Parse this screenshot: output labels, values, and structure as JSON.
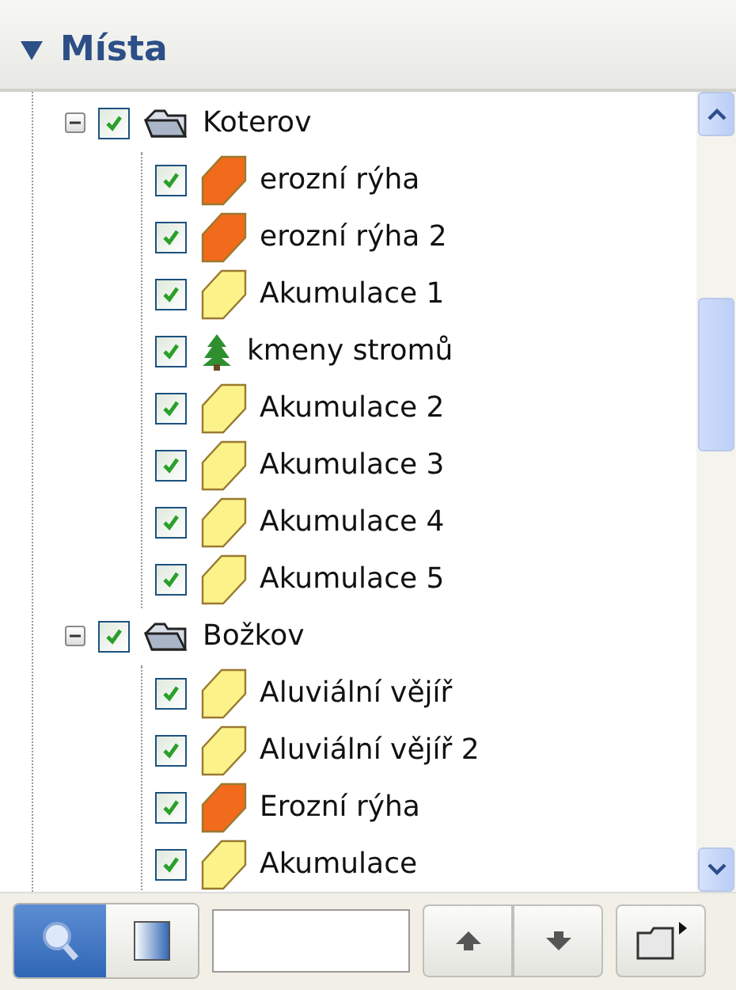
{
  "panel": {
    "title": "Místa",
    "expanded": true
  },
  "tree": [
    {
      "label": "Koterov",
      "kind": "folder",
      "checked": true,
      "expanded": true,
      "children": [
        {
          "label": "erozní rýha",
          "kind": "polygon",
          "color": "#f26a1b",
          "checked": true
        },
        {
          "label": "erozní rýha 2",
          "kind": "polygon",
          "color": "#f26a1b",
          "checked": true
        },
        {
          "label": "Akumulace 1",
          "kind": "polygon",
          "color": "#fbf38a",
          "checked": true
        },
        {
          "label": "kmeny stromů",
          "kind": "tree",
          "checked": true
        },
        {
          "label": "Akumulace 2",
          "kind": "polygon",
          "color": "#fbf38a",
          "checked": true
        },
        {
          "label": "Akumulace 3",
          "kind": "polygon",
          "color": "#fbf38a",
          "checked": true
        },
        {
          "label": "Akumulace 4",
          "kind": "polygon",
          "color": "#fbf38a",
          "checked": true
        },
        {
          "label": "Akumulace 5",
          "kind": "polygon",
          "color": "#fbf38a",
          "checked": true
        }
      ]
    },
    {
      "label": "Božkov",
      "kind": "folder",
      "checked": true,
      "expanded": true,
      "children": [
        {
          "label": "Aluviální vějíř",
          "kind": "polygon",
          "color": "#fbf38a",
          "checked": true
        },
        {
          "label": "Aluviální vějíř 2",
          "kind": "polygon",
          "color": "#fbf38a",
          "checked": true
        },
        {
          "label": "Erozní rýha",
          "kind": "polygon",
          "color": "#f26a1b",
          "checked": true
        },
        {
          "label": "Akumulace",
          "kind": "polygon",
          "color": "#fbf38a",
          "checked": true
        }
      ]
    }
  ],
  "toolbar": {
    "modes": [
      {
        "kind": "search",
        "selected": true
      },
      {
        "kind": "panel",
        "selected": false
      }
    ]
  }
}
